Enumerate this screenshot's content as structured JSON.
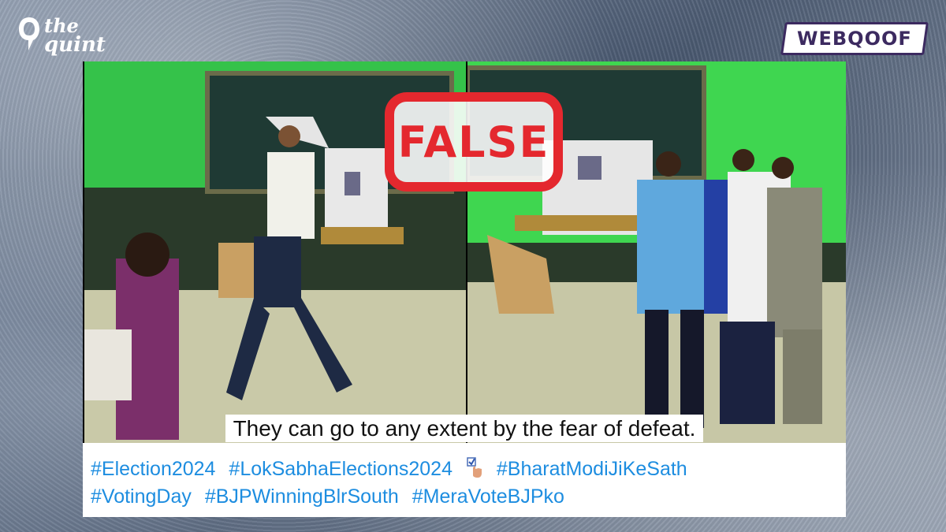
{
  "brand": {
    "logo_line1": "the",
    "logo_line2": "quint",
    "section_badge": "WEBQOOF"
  },
  "stamp": {
    "label": "FALSE",
    "color": "#e4282e"
  },
  "post": {
    "caption": "They can go to any extent by the fear of defeat.",
    "hashtag_lines": [
      [
        "#Election2024",
        "#LokSabhaElections2024",
        "#BharatModiJiKeSath"
      ],
      [
        "#VotingDay",
        "#BJPWinningBlrSouth",
        "#MeraVoteBJPko"
      ]
    ],
    "emoji": "voting-hand-icon",
    "hashtag_color": "#1d8de0"
  },
  "colors": {
    "badge_border": "#3c2a60",
    "wall_green": "#35c24a",
    "board": "#1f3a34"
  }
}
